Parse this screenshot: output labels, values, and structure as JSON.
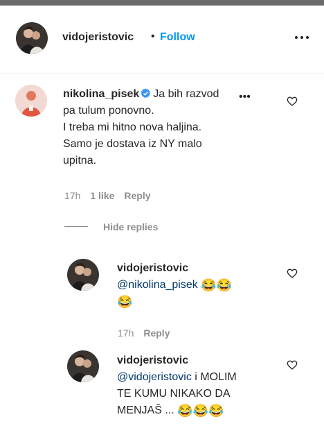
{
  "post_header": {
    "username": "vidojeristovic",
    "dot": "•",
    "follow_label": "Follow"
  },
  "comments": [
    {
      "username": "nikolina_pisek",
      "verified": true,
      "lines": [
        "Ja bih razvod",
        "pa tulum ponovno.",
        "I treba mi hitno nova haljina.",
        "Samo je dostava iz NY malo",
        "upitna."
      ],
      "time": "17h",
      "likes": "1 like",
      "reply_label": "Reply",
      "hide_replies_label": "Hide replies"
    }
  ],
  "replies": [
    {
      "username": "vidojeristovic",
      "mention": "@nikolina_pisek",
      "emoji": "😂",
      "time": "17h",
      "reply_label": "Reply"
    },
    {
      "username": "vidojeristovic",
      "mention": "@vidojeristovic",
      "text_line1": "i MOLIM",
      "text_line2": "TE KUMU NIKAKO DA",
      "text_line3": "MENJAŠ ...",
      "emoji": "😂"
    }
  ],
  "icons": {
    "more": "more-options-icon",
    "heart": "heart-outline-icon",
    "verified": "verified-badge-icon"
  },
  "colors": {
    "link_blue": "#0095f6",
    "mention": "#00376b",
    "muted": "#8e8e8e",
    "verified": "#3897f0"
  }
}
